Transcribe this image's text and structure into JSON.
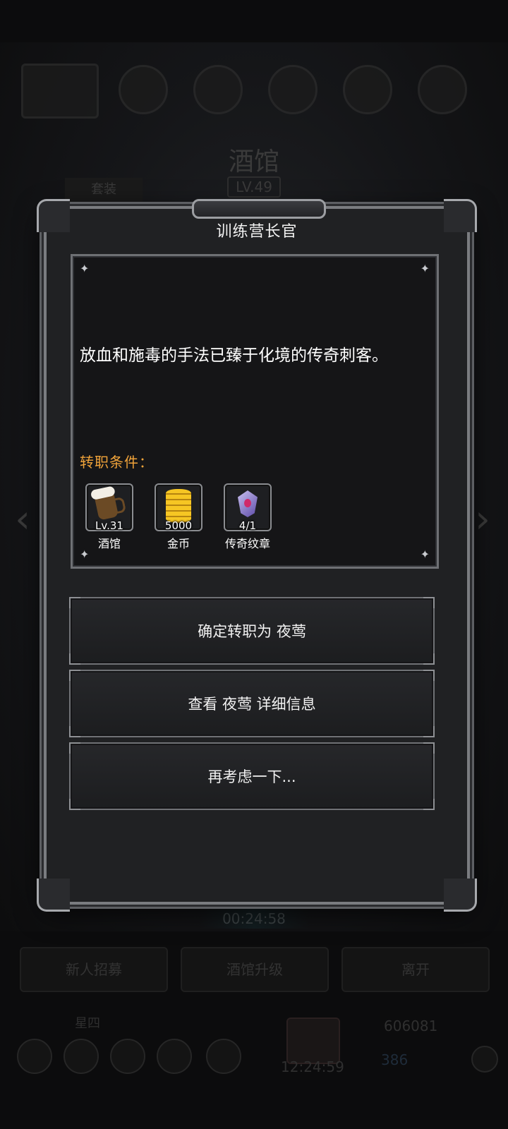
{
  "background": {
    "building_title": "酒馆",
    "building_level": "LV.49",
    "tab_label": "套装",
    "timer": "00:24:58",
    "buttons": [
      "新人招募",
      "酒馆升级",
      "离开"
    ],
    "day_label": "星四",
    "clock": "12:24:59",
    "gold_amount": "606081",
    "gem_amount": "386"
  },
  "dialog": {
    "title": "训练营长官",
    "description": "放血和施毒的手法已臻于化境的传奇刺客。",
    "requirements_label": "转职条件：",
    "requirements": [
      {
        "icon": "beer-mug-icon",
        "value": "Lv.31",
        "name": "酒馆"
      },
      {
        "icon": "gold-coins-icon",
        "value": "5000",
        "name": "金币"
      },
      {
        "icon": "legend-badge-icon",
        "value": "4/1",
        "name": "传奇纹章"
      }
    ],
    "actions": {
      "confirm": "确定转职为 夜莺",
      "details": "查看 夜莺 详细信息",
      "cancel": "再考虑一下..."
    }
  },
  "colors": {
    "requirement_label": "#f0a33a",
    "frame": "#7a7c80",
    "panel_bg": "#151517"
  }
}
